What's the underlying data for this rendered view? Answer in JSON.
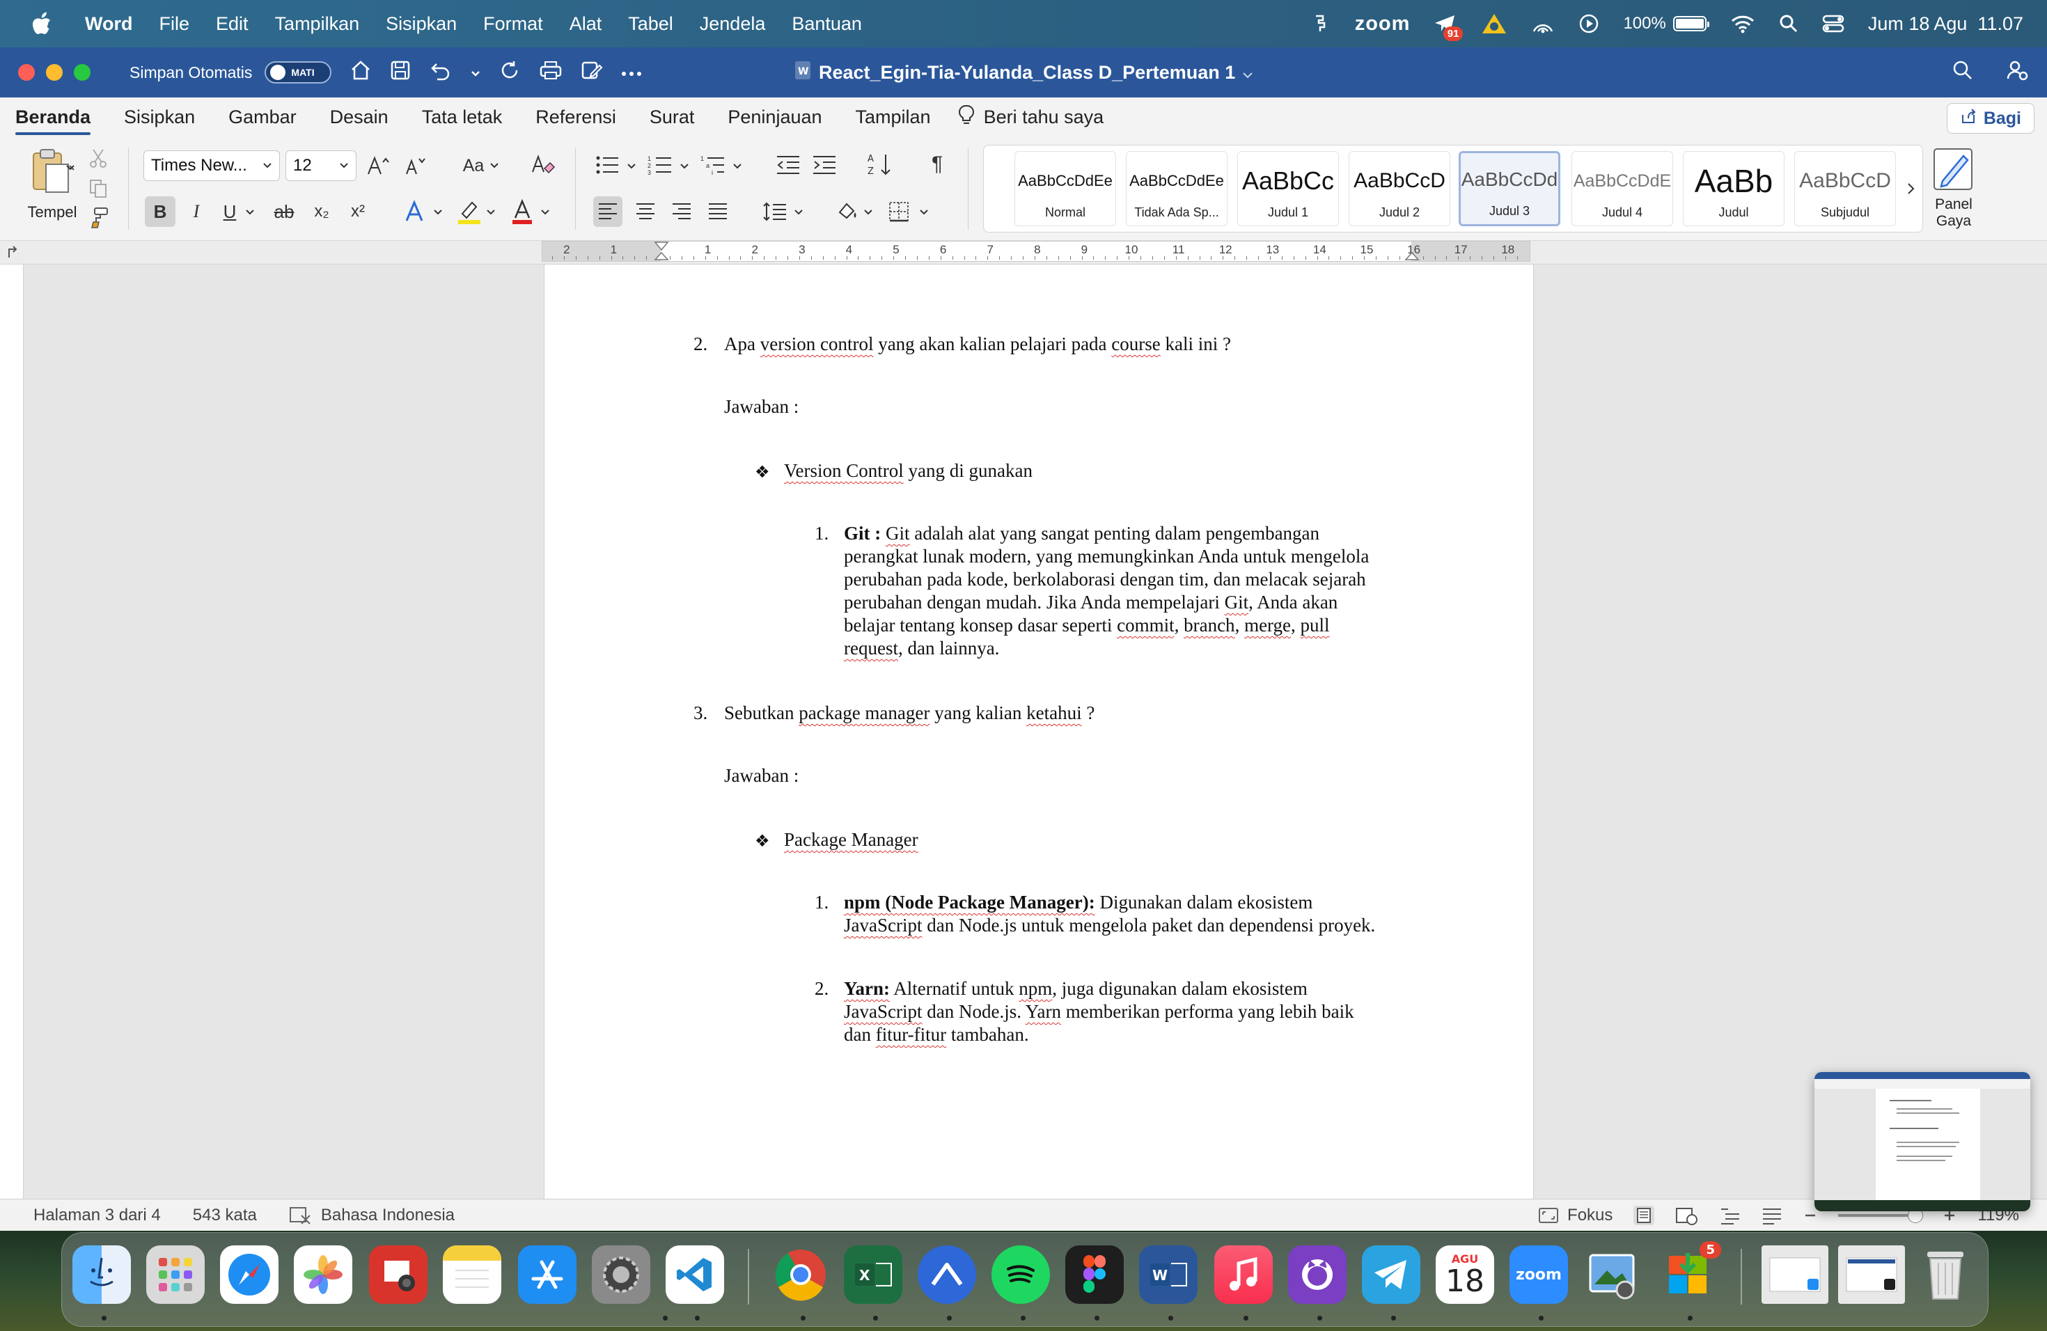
{
  "menubar": {
    "app_name": "Word",
    "menus": [
      "File",
      "Edit",
      "Tampilkan",
      "Sisipkan",
      "Format",
      "Alat",
      "Tabel",
      "Jendela",
      "Bantuan"
    ],
    "zoom_label": "zoom",
    "notification_count": "91",
    "battery_percent": "100%",
    "battery_level": 1.0,
    "datetime": "Jum 18 Agu  11.07"
  },
  "titlebar": {
    "autosave_label": "Simpan Otomatis",
    "autosave_state": "MATI",
    "document_title": "React_Egin-Tia-Yulanda_Class D_Pertemuan 1"
  },
  "ribbon_tabs": {
    "tabs": [
      "Beranda",
      "Sisipkan",
      "Gambar",
      "Desain",
      "Tata letak",
      "Referensi",
      "Surat",
      "Peninjauan",
      "Tampilan"
    ],
    "active_tab": "Beranda",
    "tell_me": "Beri tahu saya",
    "share_label": "Bagi"
  },
  "ribbon": {
    "paste_label": "Tempel",
    "font_name": "Times New...",
    "font_size": "12",
    "bold": "B",
    "italic": "I",
    "underline": "U",
    "strike": "ab",
    "subscript": "x₂",
    "superscript": "x²",
    "change_case": "Aa",
    "grow_font": "A^",
    "shrink_font": "Aˇ",
    "pilcrow": "¶",
    "styles": [
      {
        "sample": "AaBbCcDdEe",
        "name": "Normal"
      },
      {
        "sample": "AaBbCcDdEe",
        "name": "Tidak Ada Sp..."
      },
      {
        "sample": "AaBbCc",
        "name": "Judul 1"
      },
      {
        "sample": "AaBbCcD",
        "name": "Judul 2"
      },
      {
        "sample": "AaBbCcDd",
        "name": "Judul 3"
      },
      {
        "sample": "AaBbCcDdE",
        "name": "Judul 4"
      },
      {
        "sample": "AaBb",
        "name": "Judul"
      },
      {
        "sample": "AaBbCcD",
        "name": "Subjudul"
      }
    ],
    "selected_style": "Judul 3",
    "panel_label_1": "Panel",
    "panel_label_2": "Gaya"
  },
  "ruler": {
    "numbers": [
      "2",
      "1",
      "1",
      "2",
      "3",
      "4",
      "5",
      "6",
      "7",
      "8",
      "9",
      "10",
      "11",
      "12",
      "13",
      "14",
      "15",
      "16",
      "17",
      "18"
    ]
  },
  "document": {
    "q2_number": "2.",
    "q2_text_a": "Apa ",
    "q2_text_b": "version control",
    "q2_text_c": " yang akan kalian pelajari pada ",
    "q2_text_d": "course",
    "q2_text_e": " kali ini ?",
    "answer_label": "Jawaban :",
    "bullet": "❖",
    "vc_heading_a": "Version Control",
    "vc_heading_b": " yang di gunakan",
    "git_number": "1.",
    "git_lines": [
      [
        "Git : ",
        "Git",
        " adalah alat yang sangat penting dalam pengembangan"
      ],
      [
        "perangkat lunak modern, yang memungkinkan Anda untuk mengelola"
      ],
      [
        "perubahan pada kode, berkolaborasi dengan tim, dan melacak sejarah"
      ],
      [
        "perubahan dengan mudah. Jika Anda mempelajari ",
        "Git",
        ", Anda akan"
      ],
      [
        "belajar tentang konsep dasar seperti ",
        "commit",
        ", ",
        "branch",
        ", ",
        "merge",
        ", ",
        "pull"
      ],
      [
        "request",
        ", dan lainnya."
      ]
    ],
    "q3_number": "3.",
    "q3_text_a": "Sebutkan ",
    "q3_text_b": "package manager",
    "q3_text_c": " yang kalian ",
    "q3_text_d": "ketahui",
    "q3_text_e": " ?",
    "pm_heading": "Package Manager",
    "npm_number": "1.",
    "npm_bold": "npm (Node Package Manager):",
    "npm_text_1": " Digunakan dalam ekosistem",
    "npm_line2_a": "JavaScript",
    "npm_line2_b": " dan Node.js untuk mengelola paket dan dependensi proyek.",
    "yarn_number": "2.",
    "yarn_bold": "Yarn:",
    "yarn_text_1a": " Alternatif untuk ",
    "yarn_text_1b": "npm",
    "yarn_text_1c": ", juga digunakan dalam ekosistem",
    "yarn_line2_a": "JavaScript",
    "yarn_line2_b": " dan Node.js. ",
    "yarn_line2_c": "Yarn",
    "yarn_line2_d": " memberikan performa yang lebih baik",
    "yarn_line3_a": "dan ",
    "yarn_line3_b": "fitur-fitur",
    "yarn_line3_c": " tambahan."
  },
  "statusbar": {
    "page_info": "Halaman 3 dari 4",
    "word_count": "543 kata",
    "language": "Bahasa Indonesia",
    "focus_label": "Fokus",
    "zoom_level": "119%"
  },
  "dock": {
    "calendar_month": "AGU",
    "calendar_day": "18",
    "zoom_app_label": "zoom",
    "update_badge": "5"
  },
  "colors": {
    "word_blue": "#2b579a",
    "spell_red": "#d33333"
  }
}
